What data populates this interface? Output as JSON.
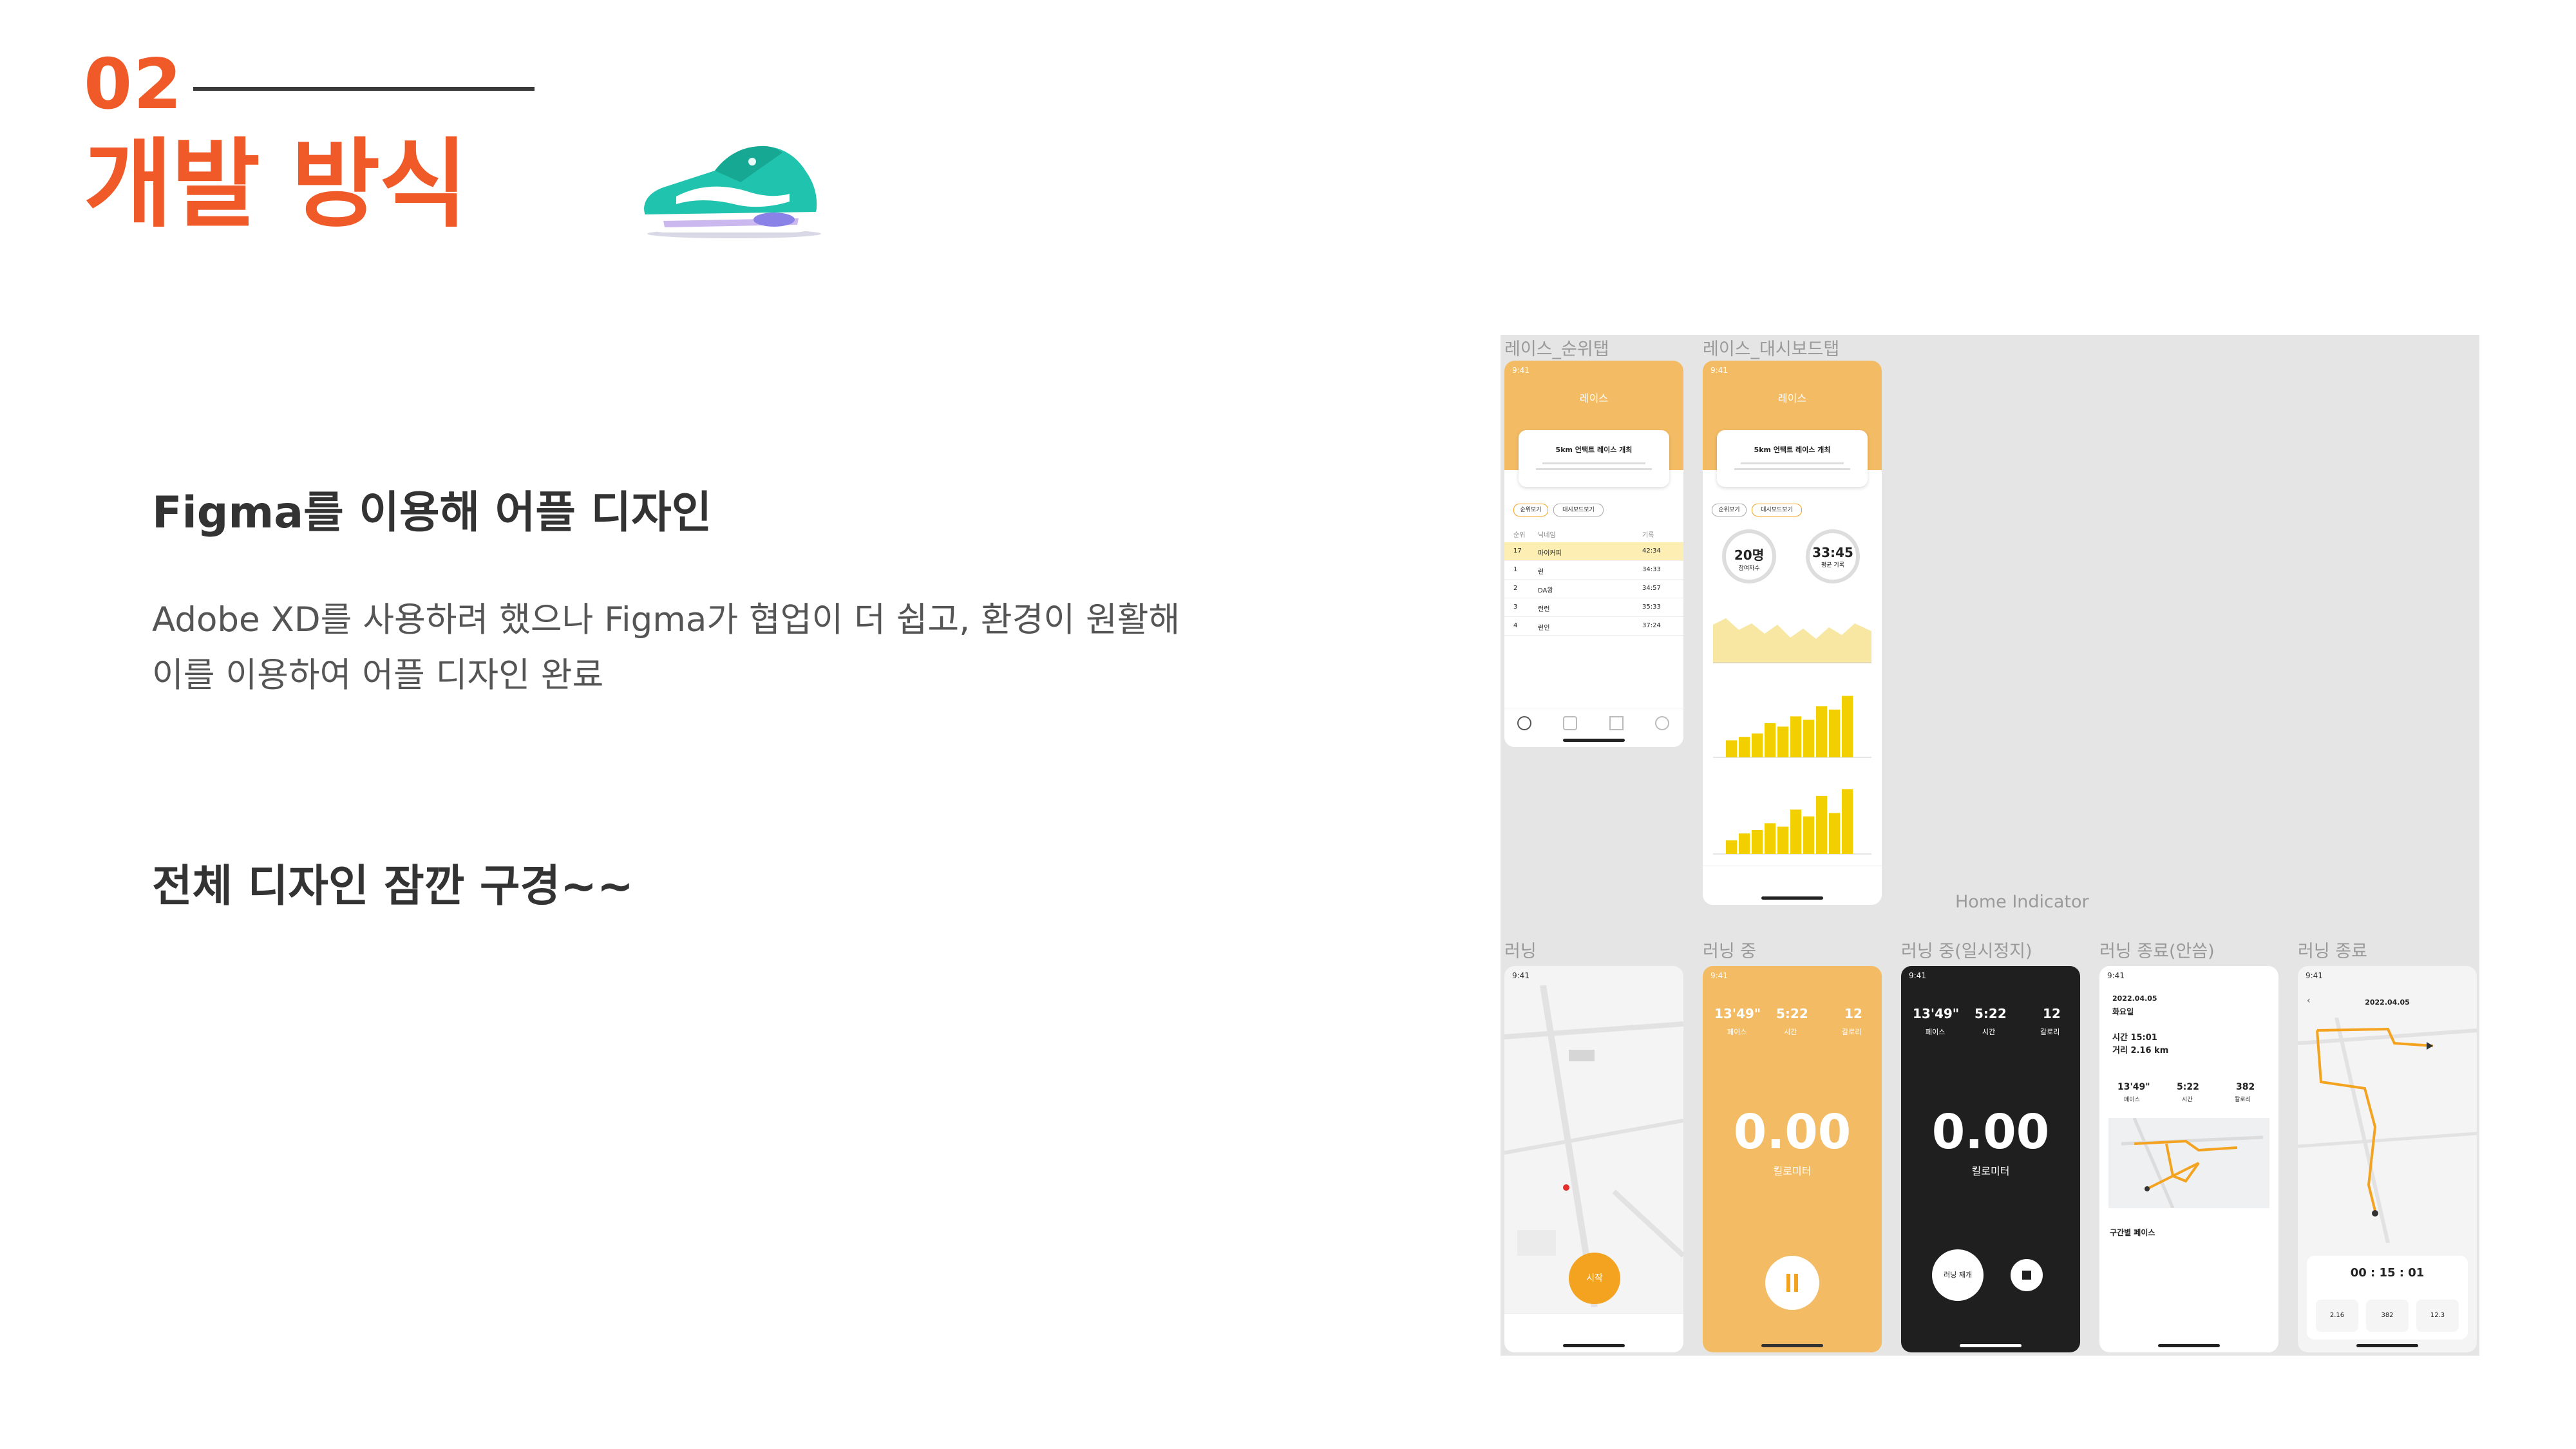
{
  "header": {
    "number": "02",
    "title": "개발 방식"
  },
  "content": {
    "subheading": "Figma를 이용해 어플 디자인",
    "body_line1": "Adobe XD를 사용하려 했으나 Figma가 협업이 더 쉽고, 환경이 원활해",
    "body_line2": "이를 이용하여 어플 디자인 완료",
    "subheading2": "전체 디자인 잠깐 구경~~"
  },
  "figma": {
    "frame_labels": {
      "race_rank": "레이스_순위탭",
      "race_dashboard": "레이스_대시보드탭",
      "home_indicator": "Home Indicator",
      "running": "러닝",
      "running_active": "러닝 중",
      "running_paused": "러닝 중(일시정지)",
      "running_end_kr": "러닝 종료(안씀)",
      "running_end": "러닝 종료"
    },
    "time": "9:41",
    "race_title": "레이스",
    "race_card_title": "5km 언택트 레이스 개최",
    "race_tabs": [
      "순위보기",
      "대시보드보기"
    ],
    "rank_headers": [
      "순위",
      "닉네임",
      "기록"
    ],
    "rank_rows": [
      {
        "rank": "17",
        "name": "마이커피",
        "time": "42:34"
      },
      {
        "rank": "1",
        "name": "런",
        "time": "34:33"
      },
      {
        "rank": "2",
        "name": "DA왕",
        "time": "34:57"
      },
      {
        "rank": "3",
        "name": "런런",
        "time": "35:33"
      },
      {
        "rank": "4",
        "name": "런인",
        "time": "37:24"
      }
    ],
    "dashboard_stats": [
      {
        "value": "20명",
        "label": "참여자수"
      },
      {
        "value": "33:45",
        "label": "평균 기록"
      }
    ],
    "chart_bars_1": [
      0.25,
      0.3,
      0.35,
      0.5,
      0.45,
      0.6,
      0.55,
      0.75,
      0.7,
      0.9
    ],
    "chart_bars_2": [
      0.2,
      0.3,
      0.35,
      0.45,
      0.4,
      0.65,
      0.55,
      0.85,
      0.6,
      0.95
    ],
    "running_metrics": [
      {
        "value": "13'49\"",
        "label": "페이스"
      },
      {
        "value": "5:22",
        "label": "시간"
      },
      {
        "value": "12",
        "label": "칼로리"
      }
    ],
    "distance": "0.00",
    "distance_unit": "킬로미터",
    "start_label": "시작",
    "resume_label": "러닝 재개",
    "end_date": "2022.04.05",
    "end_weekday": "화요일",
    "end_time_line": "시간 15:01",
    "end_distance_line": "거리 2.16 km",
    "end_metrics": [
      {
        "value": "13'49\"",
        "label": "페이스"
      },
      {
        "value": "5:22",
        "label": "시간"
      },
      {
        "value": "382",
        "label": "칼로리"
      }
    ],
    "section_pace": "구간별 페이스",
    "final_timer": "00 : 15 : 01",
    "final_stats": [
      "2.16",
      "382",
      "12.3"
    ],
    "colors": {
      "orange": "#F05A28",
      "amber": "#F3BB63",
      "accent": "#F3A320",
      "dark": "#1f1f1f"
    }
  }
}
